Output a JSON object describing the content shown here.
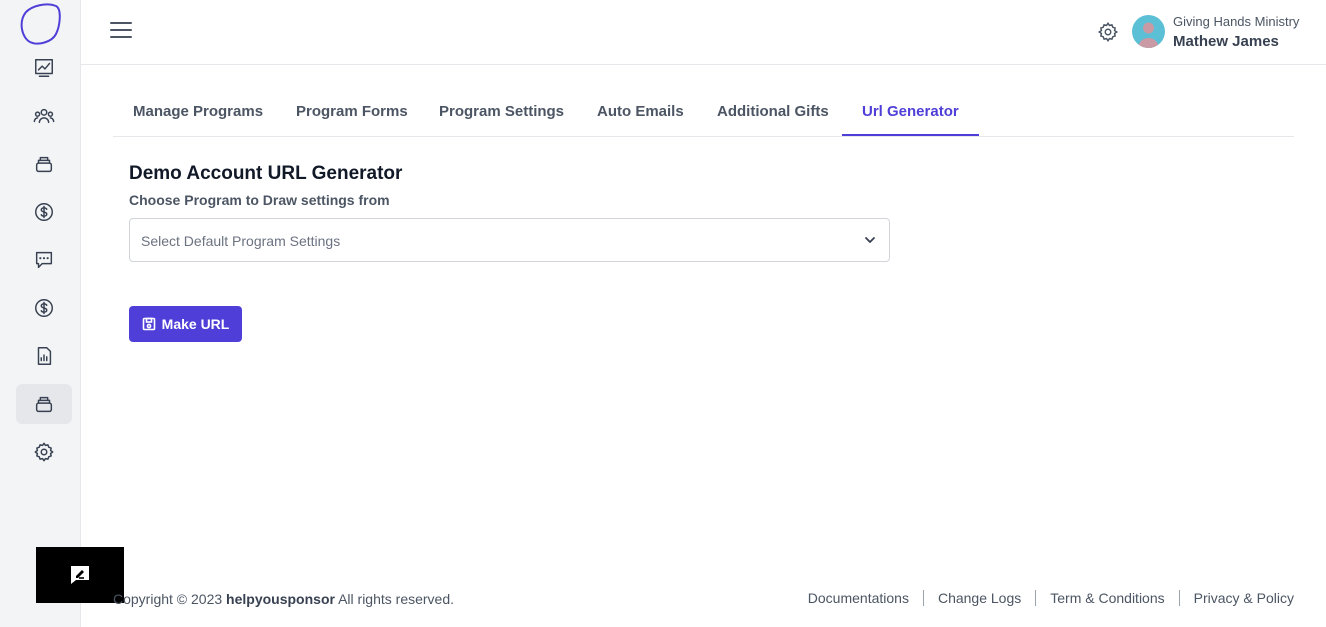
{
  "header": {
    "org_name": "Giving Hands Ministry",
    "user_name": "Mathew James"
  },
  "sidebar": {
    "items": [
      {
        "name": "dashboard",
        "icon": "chart-line-icon"
      },
      {
        "name": "sponsors",
        "icon": "users-icon"
      },
      {
        "name": "programs",
        "icon": "stack-icon"
      },
      {
        "name": "donations",
        "icon": "dollar-icon"
      },
      {
        "name": "messages",
        "icon": "chat-icon"
      },
      {
        "name": "payments",
        "icon": "dollar-icon"
      },
      {
        "name": "reports",
        "icon": "report-icon"
      },
      {
        "name": "program-setup",
        "icon": "stack-icon",
        "active": true
      },
      {
        "name": "settings",
        "icon": "gear-icon"
      }
    ]
  },
  "tabs": [
    {
      "label": "Manage Programs"
    },
    {
      "label": "Program Forms"
    },
    {
      "label": "Program Settings"
    },
    {
      "label": "Auto Emails"
    },
    {
      "label": "Additional Gifts"
    },
    {
      "label": "Url Generator",
      "active": true
    }
  ],
  "main": {
    "title": "Demo Account URL Generator",
    "subtitle": "Choose Program to Draw settings from",
    "select_placeholder": "Select Default Program Settings",
    "button_label": "Make URL"
  },
  "footer": {
    "copyright_prefix": "Copyright © 2023",
    "brand": "helpyousponsor",
    "copyright_suffix": "All rights reserved.",
    "links": [
      "Documentations",
      "Change Logs",
      "Term & Conditions",
      "Privacy & Policy"
    ]
  },
  "colors": {
    "accent": "#4f3fd8",
    "sidebar_bg": "#f3f4f6",
    "avatar_bg": "#5bbfd6"
  }
}
